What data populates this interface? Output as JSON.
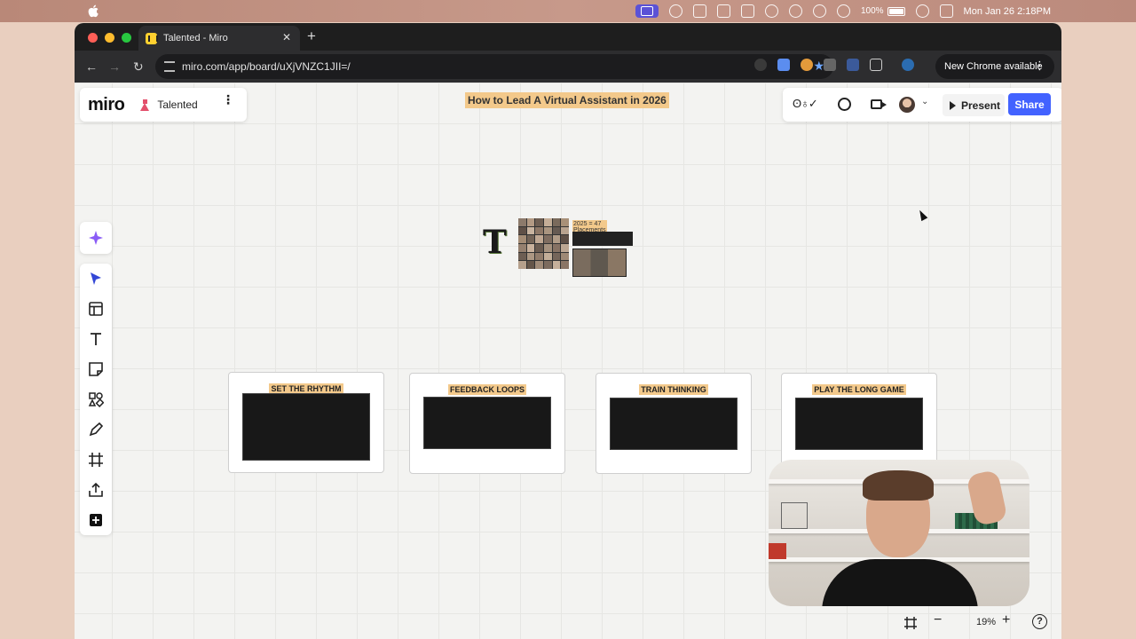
{
  "menubar": {
    "battery": "100%",
    "datetime": "Mon Jan 26  2:18PM"
  },
  "browser": {
    "tab_title": "Talented - Miro",
    "tab_close": "✕",
    "new_tab": "+",
    "url": "miro.com/app/board/uXjVNZC1JII=/",
    "update_label": "New Chrome available",
    "menu_glyph": "⋮"
  },
  "miro": {
    "logo": "miro",
    "board_name": "Talented",
    "board_menu": "⋮",
    "board_title": "How to Lead A Virtual Assistant in 2026",
    "reactions": "ʘ♁✓",
    "present_label": "Present",
    "share_label": "Share",
    "accent_color": "#4262ff",
    "highlight_color": "#f3c98b",
    "media": {
      "logo_letter": "T",
      "placements_label": "2025 = 47 Placements"
    },
    "cards": [
      {
        "title": "SET THE RHYTHM"
      },
      {
        "title": "FEEDBACK LOOPS"
      },
      {
        "title": "TRAIN THINKING"
      },
      {
        "title": "PLAY THE LONG GAME"
      }
    ],
    "tools": [
      "ai-sparkle-icon",
      "select-cursor-icon",
      "templates-icon",
      "text-icon",
      "sticky-note-icon",
      "shapes-icon",
      "pen-icon",
      "frame-icon",
      "upload-icon",
      "more-apps-icon"
    ],
    "zoom": {
      "level": "19%",
      "minus": "−",
      "plus": "+",
      "help": "?"
    }
  }
}
